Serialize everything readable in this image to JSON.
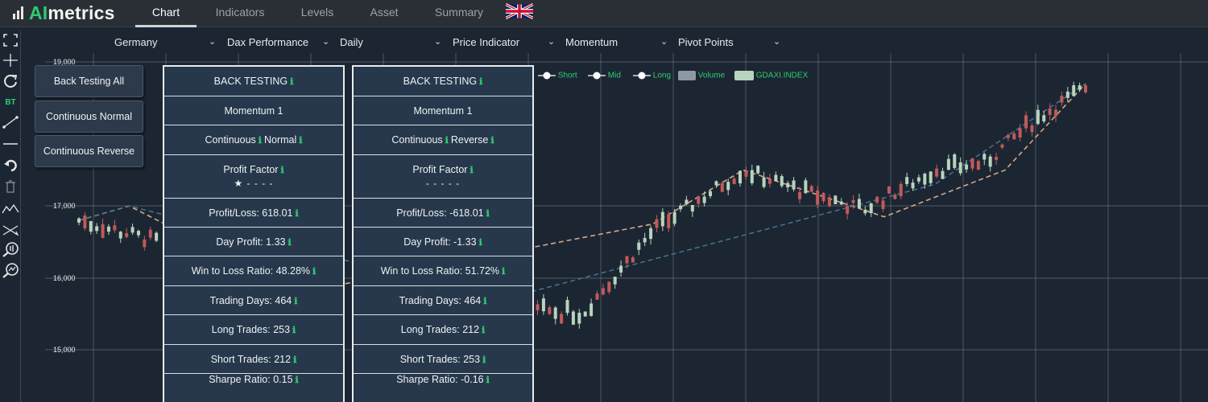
{
  "app": {
    "logo_ai": "AI",
    "logo_rest": "metrics"
  },
  "nav": {
    "tabs": [
      {
        "label": "Chart",
        "active": true
      },
      {
        "label": "Indicators",
        "active": false
      },
      {
        "label": "Levels",
        "active": false
      },
      {
        "label": "Asset",
        "active": false
      },
      {
        "label": "Summary",
        "active": false
      }
    ],
    "language_flag_icon": "uk-flag-icon"
  },
  "toolbar": {
    "tools": [
      "fullscreen-icon",
      "crosshair-icon",
      "refresh-icon",
      "bt-icon",
      "trendline-icon",
      "horizontal-line-icon",
      "undo-icon",
      "trash-icon",
      "zigzag-icon",
      "cross-lines-icon",
      "zoom-volume-icon",
      "zoom-chart-icon"
    ],
    "bt_label": "BT"
  },
  "filters": {
    "country": "Germany",
    "index": "Dax Performance",
    "timeframe": "Daily",
    "indicator_type": "Price Indicator",
    "indicator": "Momentum",
    "levels": "Pivot Points"
  },
  "chart": {
    "y_ticks": [
      "19,000",
      "17,000",
      "16,000",
      "15,000"
    ],
    "legend": [
      {
        "label": "Short",
        "color": "#ffffff"
      },
      {
        "label": "Mid",
        "color": "#ffffff"
      },
      {
        "label": "Long",
        "color": "#ffffff"
      },
      {
        "label": "Volume",
        "color": "#8e9aa3"
      },
      {
        "label": "GDAXI.INDEX",
        "color": "#b7d4bd"
      }
    ],
    "colors": {
      "up": "#b7d4bd",
      "down": "#c05a5a",
      "short_line": "#d9a784",
      "long_line": "#4b7897",
      "grid": "#9aa6b0",
      "background": "#1c2633"
    }
  },
  "chart_data": {
    "type": "line",
    "title": "",
    "xlabel": "",
    "ylabel": "",
    "ylim": [
      14000,
      19000
    ],
    "y_ticks": [
      19000,
      17000,
      16000,
      15000
    ],
    "series": [
      {
        "name": "Short",
        "x": [
          0,
          0.05,
          0.22,
          0.57,
          0.66,
          0.8,
          0.92,
          1.0
        ],
        "values": [
          16300,
          16500,
          15300,
          16250,
          17000,
          16350,
          17000,
          18200
        ]
      },
      {
        "name": "Long",
        "x": [
          0,
          0.05,
          0.42,
          0.85,
          1.0
        ],
        "values": [
          16300,
          16500,
          15200,
          16800,
          18200
        ]
      },
      {
        "name": "GDAXI.INDEX",
        "x": [
          0.0,
          0.08,
          0.18,
          0.32,
          0.5,
          0.57,
          0.66,
          0.72,
          0.78,
          0.85,
          0.9,
          0.95,
          1.0
        ],
        "values": [
          16300,
          16000,
          15500,
          15200,
          15000,
          16150,
          17000,
          16700,
          16450,
          17000,
          17100,
          17700,
          18150
        ]
      }
    ]
  },
  "side_buttons": [
    "Back Testing All Sistems",
    "Continuous Normal",
    "Continuous Reverse"
  ],
  "panels": [
    {
      "title": "BACK TESTING",
      "rows": [
        {
          "text": "Momentum 1",
          "info": false
        },
        {
          "text": "Continuous",
          "info_mid": true,
          "text2": "Normal"
        },
        {
          "text": "Profit Factor",
          "info": true,
          "sub": "★ - - - -"
        },
        {
          "text": "Profit/Loss: 618.01",
          "info": true
        },
        {
          "text": "Day Profit: 1.33",
          "info": true
        },
        {
          "text": "Win to Loss Ratio: 48.28%",
          "info": true
        },
        {
          "text": "Trading Days: 464",
          "info": true
        },
        {
          "text": "Long Trades: 253",
          "info": true
        },
        {
          "text": "Short Trades: 212",
          "info": true
        },
        {
          "text": "Sharpe Ratio: 0.15",
          "info": true
        }
      ]
    },
    {
      "title": "BACK TESTING",
      "rows": [
        {
          "text": "Momentum 1",
          "info": false
        },
        {
          "text": "Continuous",
          "info_mid": true,
          "text2": "Reverse"
        },
        {
          "text": "Profit Factor",
          "info": true,
          "sub": "- - - - -"
        },
        {
          "text": "Profit/Loss: -618.01",
          "info": true
        },
        {
          "text": "Day Profit: -1.33",
          "info": true
        },
        {
          "text": "Win to Loss Ratio: 51.72%",
          "info": true
        },
        {
          "text": "Trading Days: 464",
          "info": true
        },
        {
          "text": "Long Trades: 212",
          "info": true
        },
        {
          "text": "Short Trades: 253",
          "info": true
        },
        {
          "text": "Sharpe Ratio: -0.16",
          "info": true
        }
      ]
    }
  ],
  "info_glyph": "ℹ"
}
